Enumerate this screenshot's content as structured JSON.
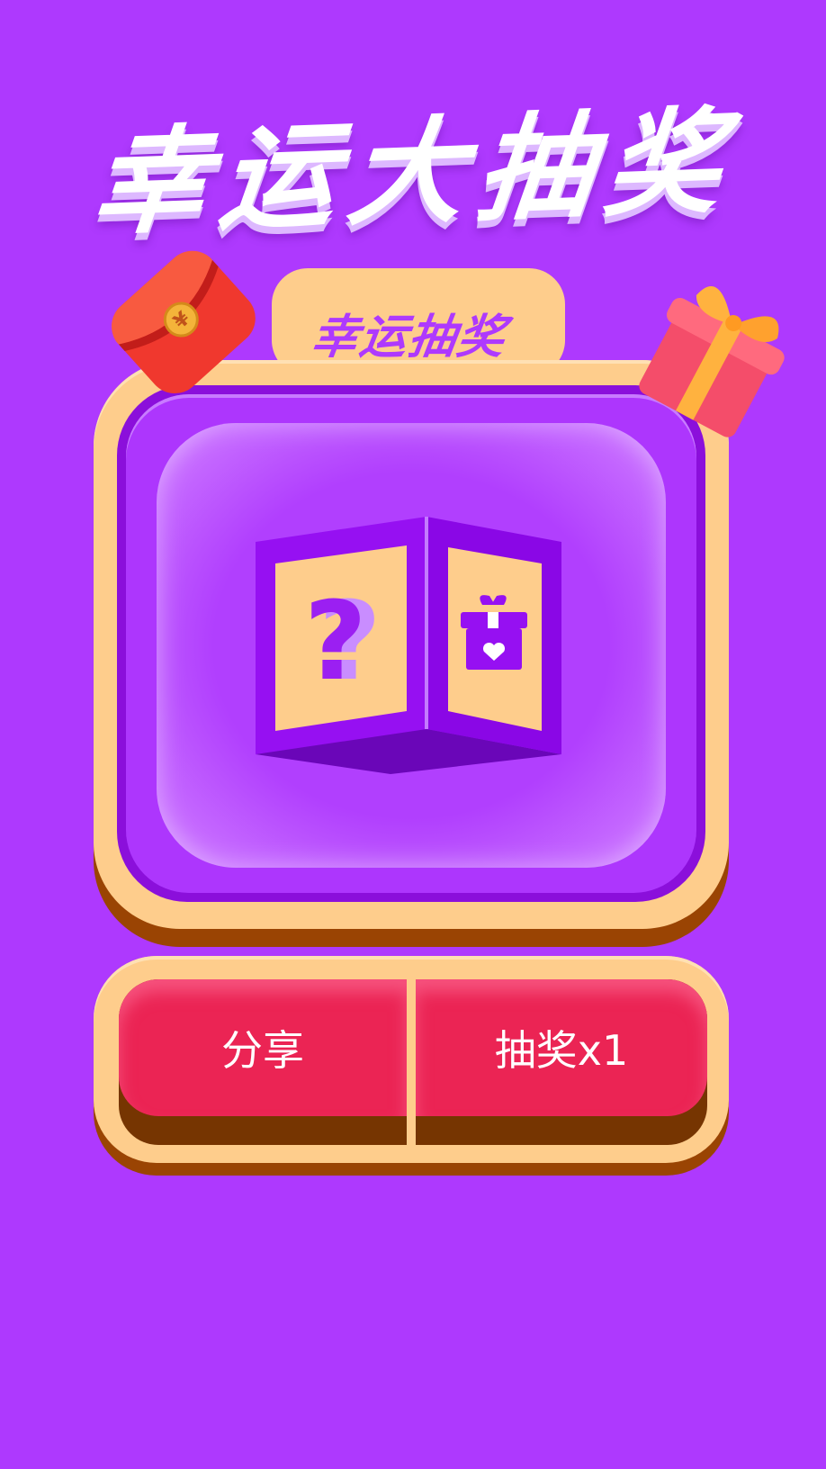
{
  "page": {
    "title": "幸运大抽奖",
    "background_color": "#ae39fe"
  },
  "panel": {
    "tab_title": "幸运抽奖",
    "mystery_icon": "question-mark-icon",
    "prize_icon": "gift-heart-icon"
  },
  "decorations": {
    "left": "red-envelope-icon",
    "right": "gift-box-icon"
  },
  "actions": {
    "share_label": "分享",
    "draw_label": "抽奖x1"
  },
  "colors": {
    "accent_purple": "#ae39fe",
    "panel_cream": "#fecd8c",
    "button_red": "#eb2454",
    "shadow_brown": "#9a4403"
  }
}
